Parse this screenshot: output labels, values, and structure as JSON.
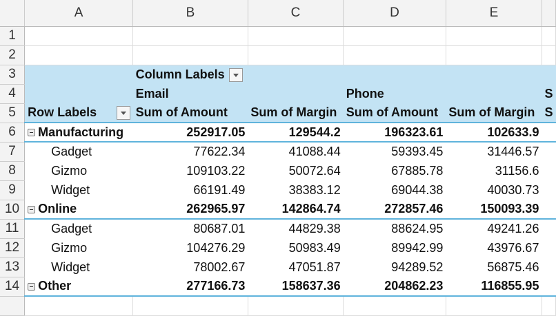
{
  "columns": [
    "A",
    "B",
    "C",
    "D",
    "E"
  ],
  "row_numbers": [
    "1",
    "2",
    "3",
    "4",
    "5",
    "6",
    "7",
    "8",
    "9",
    "10",
    "11",
    "12",
    "13",
    "14"
  ],
  "pivot": {
    "column_labels": "Column Labels",
    "row_labels": "Row Labels",
    "groups": [
      "Email",
      "Phone",
      "S"
    ],
    "measures": [
      "Sum of Amount",
      "Sum of Margin",
      "Sum of Amount",
      "Sum of Margin",
      "S"
    ],
    "rows": [
      {
        "label": "Manufacturing",
        "type": "group",
        "values": [
          "252917.05",
          "129544.2",
          "196323.61",
          "102633.9"
        ]
      },
      {
        "label": "Gadget",
        "type": "item",
        "values": [
          "77622.34",
          "41088.44",
          "59393.45",
          "31446.57"
        ]
      },
      {
        "label": "Gizmo",
        "type": "item",
        "values": [
          "109103.22",
          "50072.64",
          "67885.78",
          "31156.6"
        ]
      },
      {
        "label": "Widget",
        "type": "item",
        "values": [
          "66191.49",
          "38383.12",
          "69044.38",
          "40030.73"
        ]
      },
      {
        "label": "Online",
        "type": "group",
        "values": [
          "262965.97",
          "142864.74",
          "272857.46",
          "150093.39"
        ]
      },
      {
        "label": "Gadget",
        "type": "item",
        "values": [
          "80687.01",
          "44829.38",
          "88624.95",
          "49241.26"
        ]
      },
      {
        "label": "Gizmo",
        "type": "item",
        "values": [
          "104276.29",
          "50983.49",
          "89942.99",
          "43976.67"
        ]
      },
      {
        "label": "Widget",
        "type": "item",
        "values": [
          "78002.67",
          "47051.87",
          "94289.52",
          "56875.46"
        ]
      },
      {
        "label": "Other",
        "type": "group",
        "values": [
          "277166.73",
          "158637.36",
          "204862.23",
          "116855.95"
        ]
      }
    ]
  },
  "colors": {
    "pivot_header": "#c3e3f4",
    "pivot_border": "#5fb3dc"
  }
}
